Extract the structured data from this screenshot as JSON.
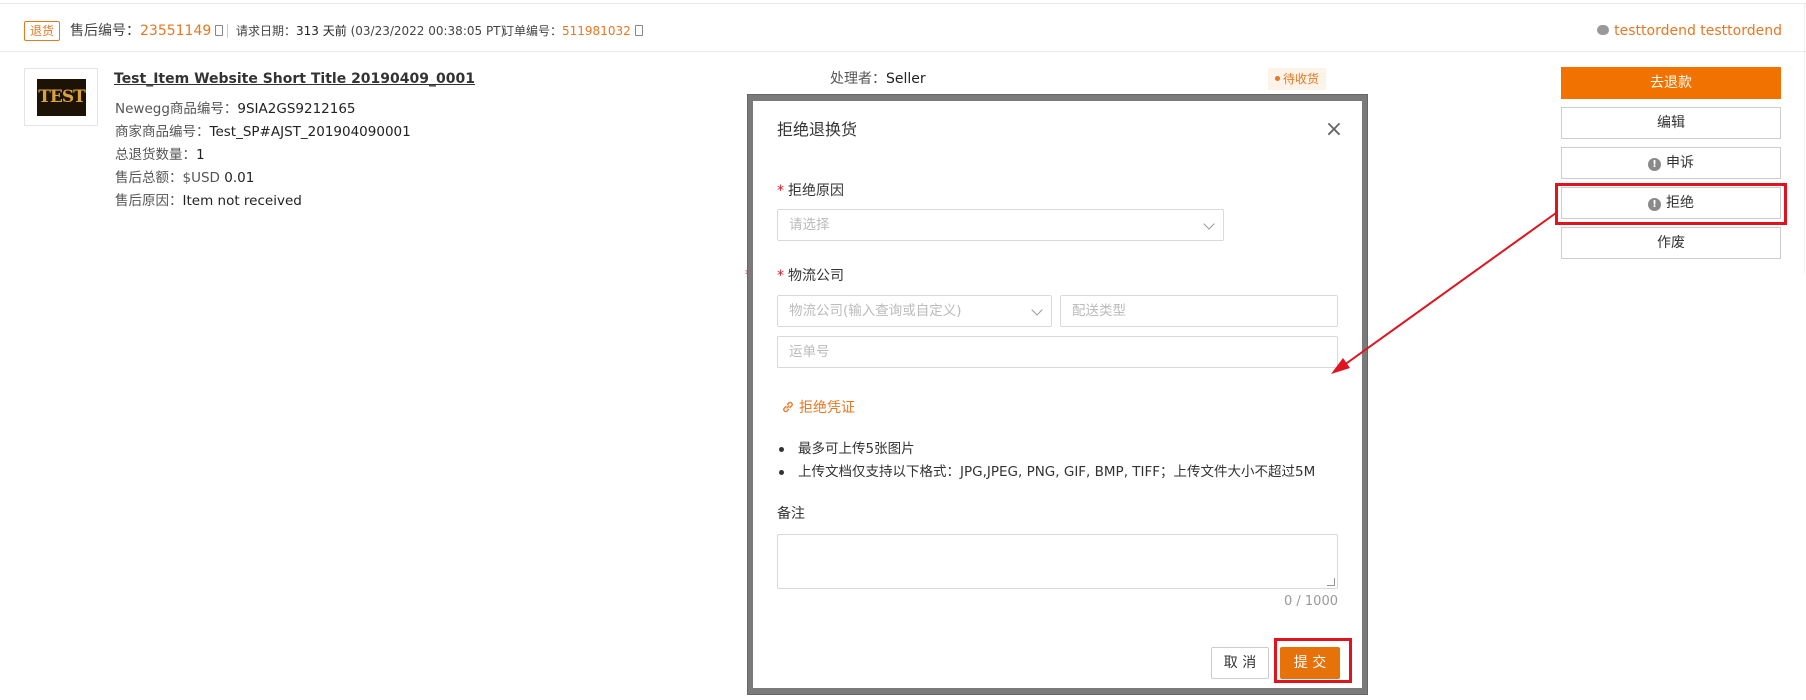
{
  "header": {
    "type_tag": "退货",
    "rma_label": "售后编号：",
    "rma_number": "23551149",
    "request_date_label": "请求日期：",
    "request_date_value": "313 天前",
    "request_date_detail": "(03/23/2022 00:38:05 PT)",
    "order_label": "订单编号：",
    "order_number": "511981032",
    "customer_name": "testtordend testtordend"
  },
  "product": {
    "logo_text": "TEST",
    "title": "Test_Item Website Short Title 20190409_0001",
    "rows": [
      {
        "label": "Newegg商品编号：",
        "value": "9SIA2GS9212165"
      },
      {
        "label": "商家商品编号：",
        "value": "Test_SP#AJST_201904090001"
      },
      {
        "label": "总退货数量：",
        "value": "1"
      },
      {
        "label": "售后总额：",
        "unit": "$USD",
        "value": "0.01"
      },
      {
        "label": "售后原因：",
        "value": "Item not received"
      }
    ],
    "handler_label": "处理者：",
    "handler_value": "Seller",
    "status": "待收货"
  },
  "actions": {
    "refund": "去退款",
    "edit": "编辑",
    "appeal": "申诉",
    "reject": "拒绝",
    "void": "作废"
  },
  "dialog": {
    "title": "拒绝退换货",
    "reason_label": "拒绝原因",
    "reason_placeholder": "请选择",
    "logistics_label": "物流公司",
    "carrier_placeholder": "物流公司(输入查询或自定义)",
    "ship_type_placeholder": "配送类型",
    "tracking_placeholder": "运单号",
    "evidence_link": "拒绝凭证",
    "notes": [
      "最多可上传5张图片",
      "上传文档仅支持以下格式：JPG,JPEG, PNG, GIF, BMP, TIFF；上传文件大小不超过5M"
    ],
    "remark_label": "备注",
    "counter": "0 / 1000",
    "cancel": "取 消",
    "submit": "提 交"
  },
  "colors": {
    "accent": "#e87722",
    "primary_button": "#f27200",
    "highlight": "#e0141e"
  }
}
